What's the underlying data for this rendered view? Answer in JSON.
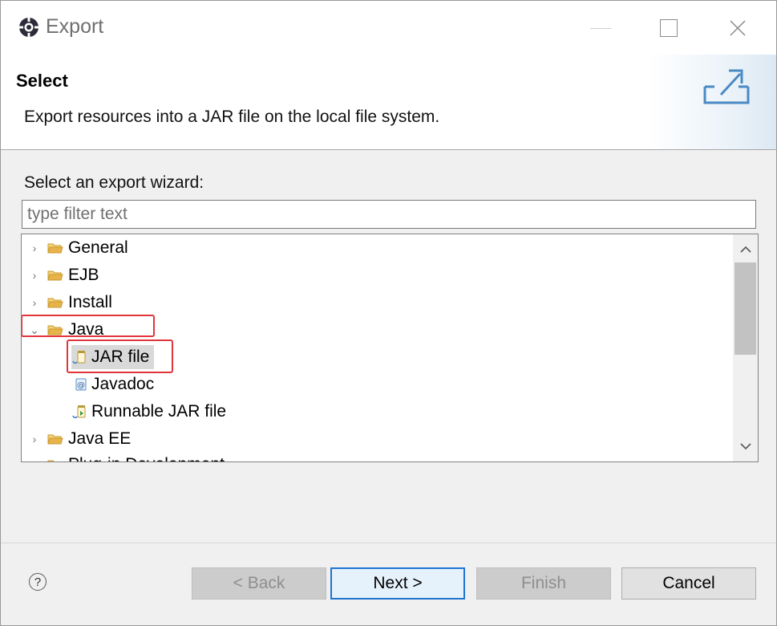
{
  "window": {
    "title": "Export"
  },
  "header": {
    "heading": "Select",
    "description": "Export resources into a JAR file on the local file system."
  },
  "wizard": {
    "label": "Select an export wizard:",
    "filter_placeholder": "type filter text",
    "filter_value": "",
    "tree": [
      {
        "label": "General",
        "expanded": false,
        "icon": "folder-icon"
      },
      {
        "label": "EJB",
        "expanded": false,
        "icon": "folder-icon"
      },
      {
        "label": "Install",
        "expanded": false,
        "icon": "folder-icon"
      },
      {
        "label": "Java",
        "expanded": true,
        "icon": "folder-icon",
        "children": [
          {
            "label": "JAR file",
            "selected": true,
            "icon": "jar-file-icon"
          },
          {
            "label": "Javadoc",
            "selected": false,
            "icon": "javadoc-icon"
          },
          {
            "label": "Runnable JAR file",
            "selected": false,
            "icon": "runnable-jar-icon"
          }
        ]
      },
      {
        "label": "Java EE",
        "expanded": false,
        "icon": "folder-icon"
      },
      {
        "label": "Plug-in Development",
        "expanded": false,
        "icon": "folder-icon"
      }
    ]
  },
  "buttons": {
    "back": "< Back",
    "next": "Next >",
    "finish": "Finish",
    "cancel": "Cancel",
    "help": "?"
  },
  "colors": {
    "highlight": "#e0353b",
    "default_button_border": "#1f74d0",
    "folder": "#e8b34a"
  }
}
